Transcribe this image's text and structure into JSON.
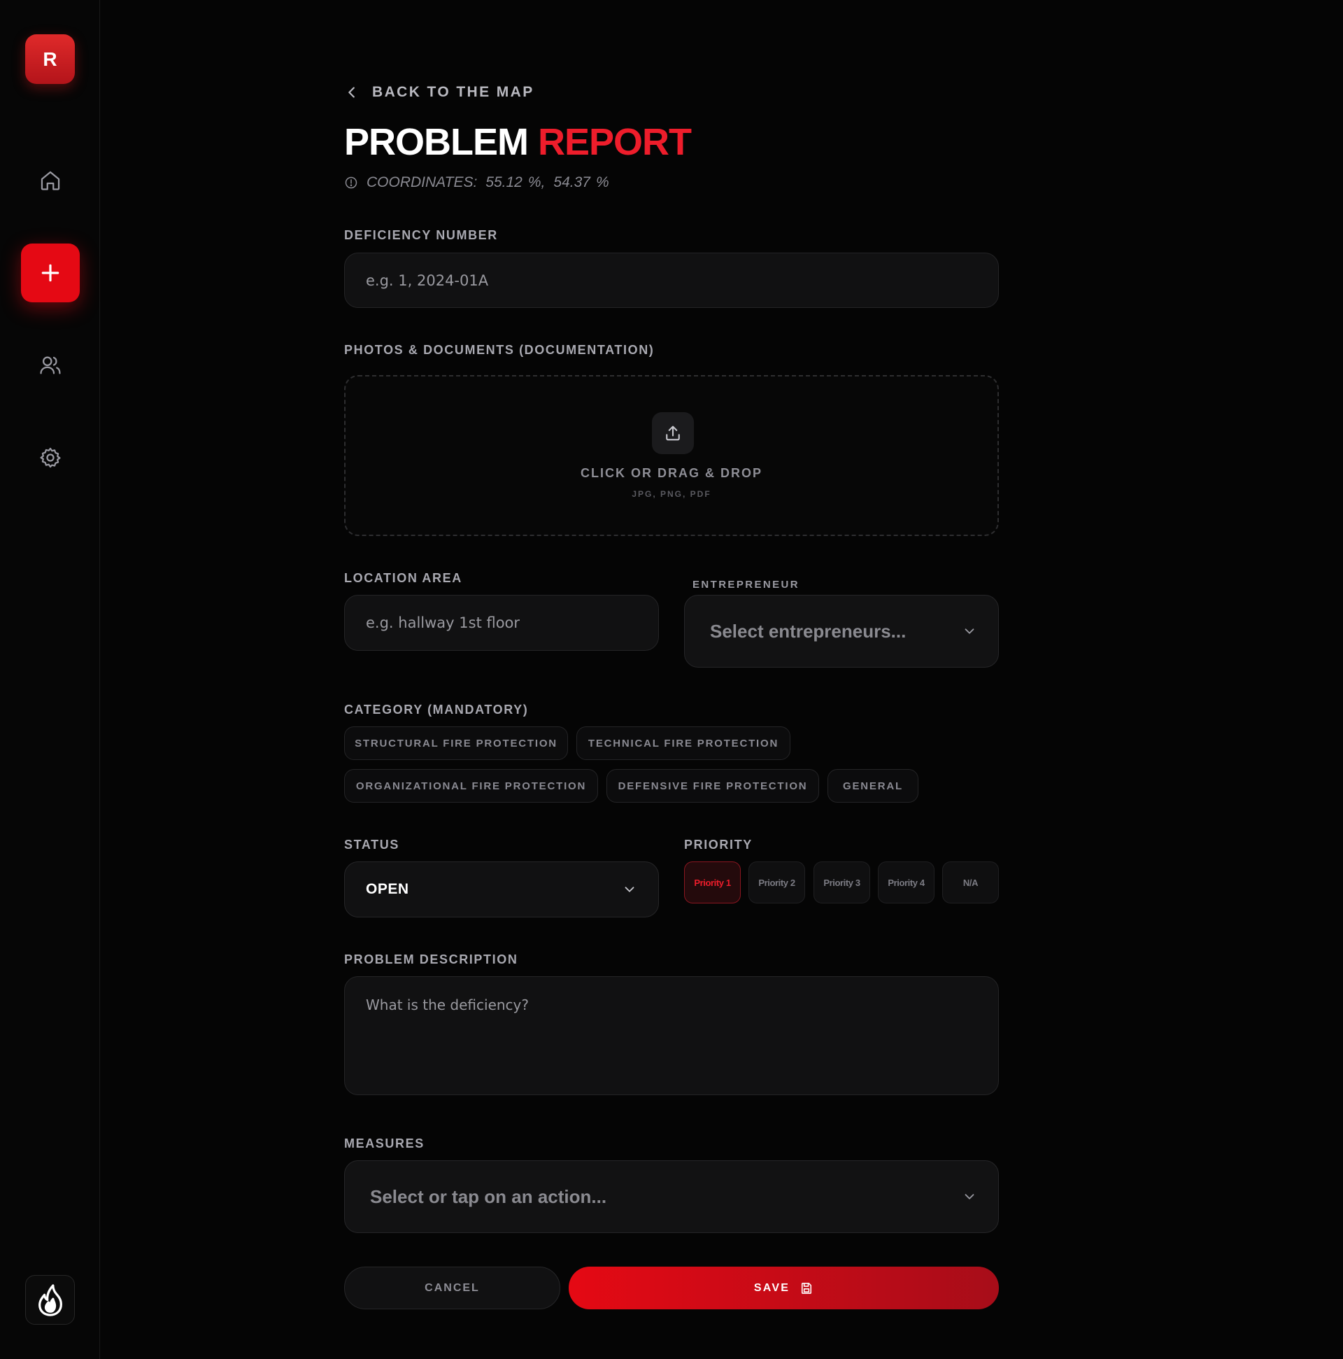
{
  "sidebar": {
    "logo_letter": "R",
    "items": [
      {
        "name": "home-icon"
      },
      {
        "name": "plus-icon"
      },
      {
        "name": "users-icon"
      },
      {
        "name": "gear-icon"
      }
    ],
    "footer_icon": "flame-icon"
  },
  "header": {
    "back_label": "BACK TO THE MAP",
    "title_part1": "PROBLEM",
    "title_part2": "REPORT",
    "coords_label": "COORDINATES:",
    "coord_x": "55.12",
    "coord_y": "54.37",
    "coord_unit": "%"
  },
  "form": {
    "deficiency": {
      "label": "DEFICIENCY NUMBER",
      "placeholder": "e.g. 1, 2024-01A"
    },
    "documentation": {
      "label": "PHOTOS & DOCUMENTS (DOCUMENTATION)",
      "main": "CLICK OR DRAG & DROP",
      "sub": "JPG, PNG, PDF"
    },
    "location": {
      "label": "LOCATION AREA",
      "placeholder": "e.g. hallway 1st floor"
    },
    "entrepreneur": {
      "label": "ENTREPRENEUR",
      "placeholder": "Select entrepreneurs..."
    },
    "category": {
      "label": "CATEGORY (MANDATORY)",
      "options": [
        "STRUCTURAL FIRE PROTECTION",
        "TECHNICAL FIRE PROTECTION",
        "ORGANIZATIONAL FIRE PROTECTION",
        "DEFENSIVE FIRE PROTECTION",
        "GENERAL"
      ]
    },
    "status": {
      "label": "STATUS",
      "value": "OPEN"
    },
    "priority": {
      "label": "PRIORITY",
      "options": [
        "Priority 1",
        "Priority 2",
        "Priority 3",
        "Priority 4",
        "N/A"
      ],
      "selected": "Priority 1"
    },
    "description": {
      "label": "PROBLEM DESCRIPTION",
      "placeholder": "What is the deficiency?"
    },
    "measures": {
      "label": "MEASURES",
      "placeholder": "Select or tap on an action..."
    },
    "cancel_label": "CANCEL",
    "save_label": "SAVE"
  },
  "colors": {
    "accent": "#e50914",
    "background": "#050505",
    "surface": "#111112"
  }
}
